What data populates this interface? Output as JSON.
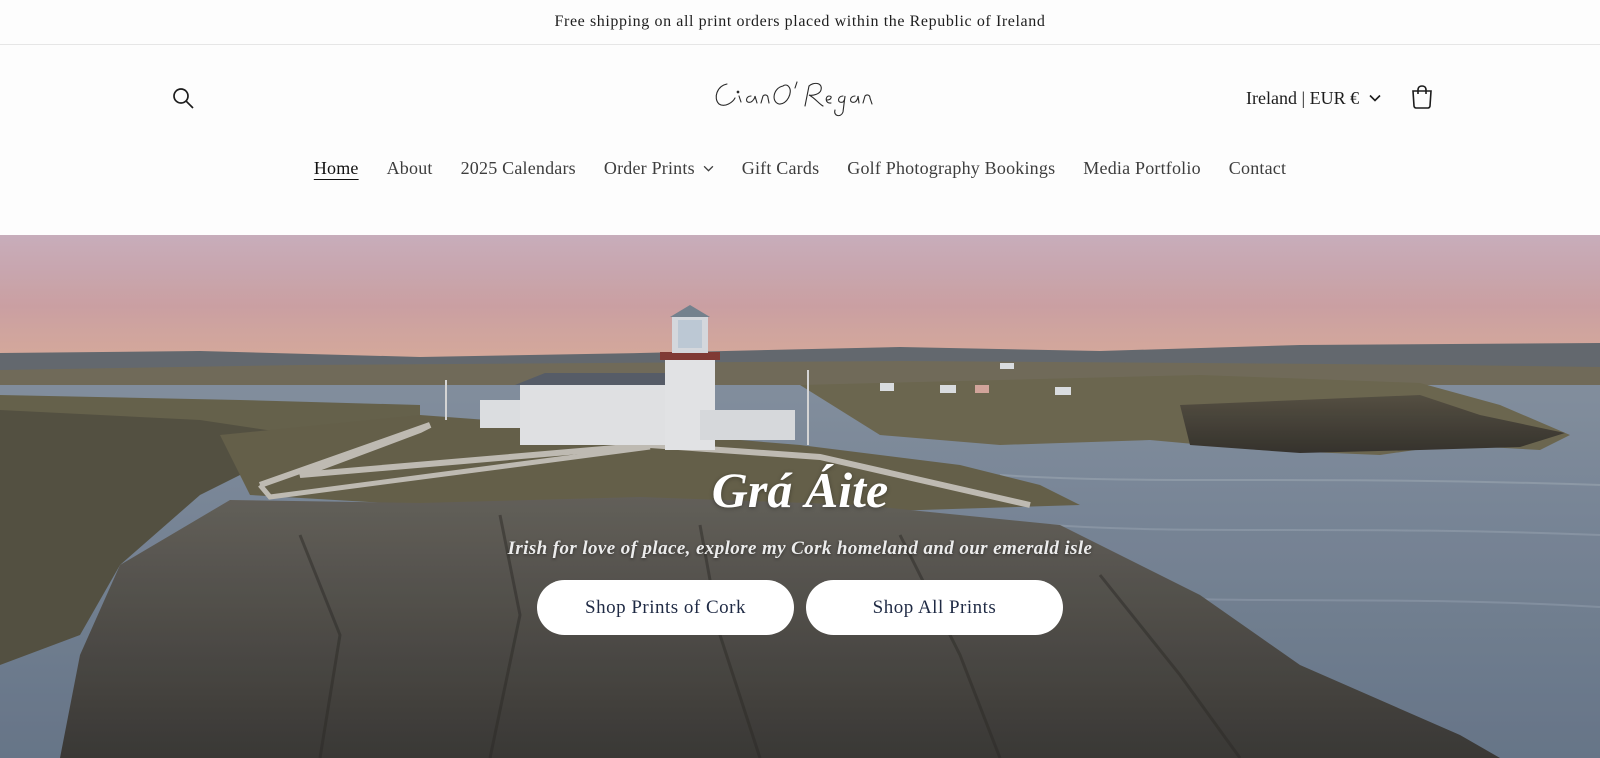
{
  "announcement": {
    "text": "Free shipping on all print orders placed within the Republic of Ireland"
  },
  "header": {
    "logo_text": "Cian O'Regan",
    "locale_label": "Ireland | EUR €",
    "search_icon": "search-icon",
    "cart_icon": "cart-icon"
  },
  "nav": {
    "items": [
      {
        "label": "Home",
        "active": true
      },
      {
        "label": "About"
      },
      {
        "label": "2025 Calendars"
      },
      {
        "label": "Order Prints",
        "has_dropdown": true
      },
      {
        "label": "Gift Cards"
      },
      {
        "label": "Golf Photography Bookings"
      },
      {
        "label": "Media Portfolio"
      },
      {
        "label": "Contact"
      }
    ]
  },
  "hero": {
    "title": "Grá Áite",
    "subtitle": "Irish for love of place, explore my Cork homeland and our emerald isle",
    "buttons": [
      {
        "label": "Shop Prints of Cork"
      },
      {
        "label": "Shop All Prints"
      }
    ]
  },
  "colors": {
    "button_text": "#1f2a44",
    "sky_top": "#d8b9c9",
    "sea": "#7f8fa3"
  }
}
